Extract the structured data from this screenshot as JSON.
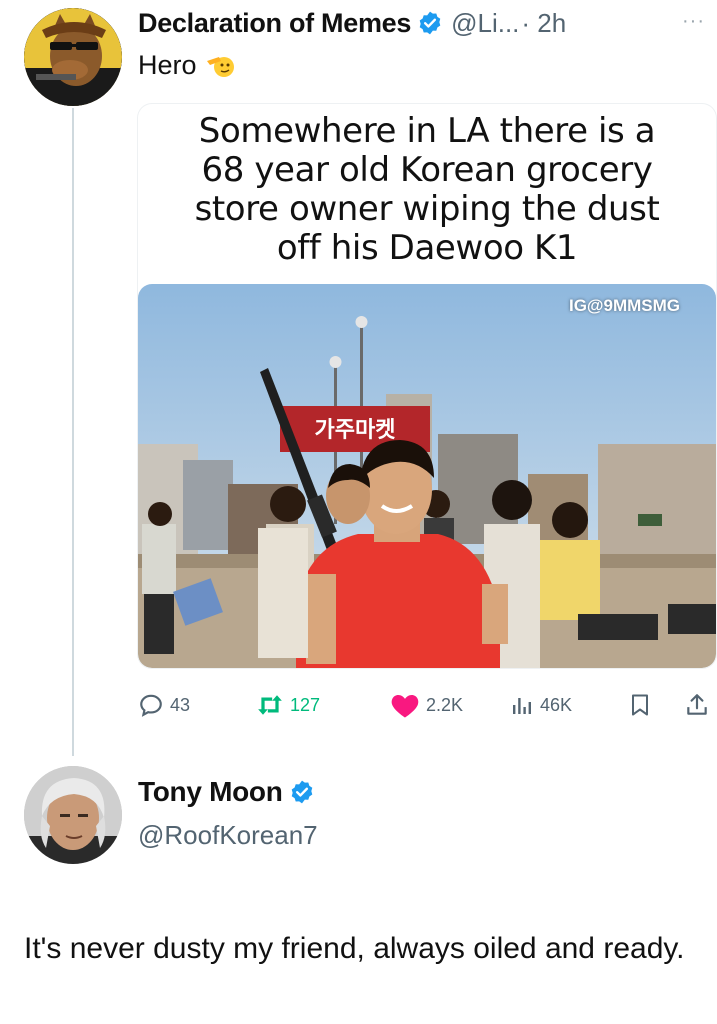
{
  "tweet": {
    "author_name": "Declaration of Memes",
    "handle": "@Li...",
    "time": "· 2h",
    "more": "···",
    "text": "Hero",
    "icons": {
      "verified": "verified-badge-icon",
      "emoji": "saluting-hand-emoji"
    },
    "meme": {
      "caption_lines": [
        "Somewhere in LA there is a",
        "68 year old Korean grocery",
        "store owner wiping the dust",
        "off his Daewoo K1"
      ],
      "watermark": "IG@9MMSMG",
      "sign_text": "가주마켓"
    },
    "actions": {
      "replies": "43",
      "retweets": "127",
      "likes": "2.2K",
      "views": "46K"
    }
  },
  "reply": {
    "author_name": "Tony Moon",
    "handle": "@RoofKorean7",
    "text": "It's never dusty my friend, always oiled and ready."
  },
  "colors": {
    "verified": "#1d9bf0",
    "like": "#f91880",
    "retweet": "#00ba7c",
    "muted": "#536471"
  }
}
